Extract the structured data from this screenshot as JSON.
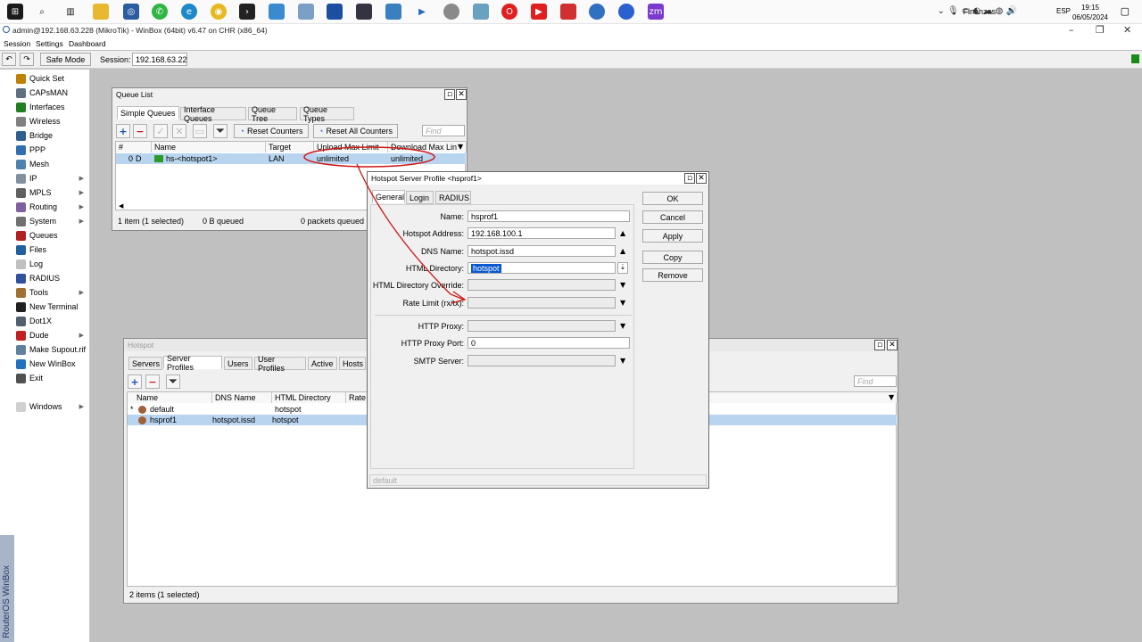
{
  "taskbar": {
    "tray_label": "Finanzas",
    "lang": "ESP",
    "time": "19:15",
    "date": "06/05/2024",
    "icons": [
      "windows-start-icon",
      "search-icon",
      "task-view-icon",
      "file-explorer-icon",
      "winbox-icon",
      "whatsapp-icon",
      "edge-icon",
      "chrome-icon",
      "terminal-icon",
      "app-icon",
      "app-icon",
      "app-icon",
      "app-icon",
      "app-icon",
      "media-player-icon",
      "app-icon",
      "app-icon",
      "opera-icon",
      "youtube-icon",
      "app-icon",
      "browser-icon",
      "zoom-icon"
    ],
    "zoom_label": "zm"
  },
  "window": {
    "title": "admin@192.168.63.228 (MikroTik) - WinBox (64bit) v6.47 on CHR (x86_64)",
    "menu": [
      "Session",
      "Settings",
      "Dashboard"
    ],
    "safe_mode": "Safe Mode",
    "session_label": "Session:",
    "session_value": "192.168.63.228"
  },
  "sidebar": {
    "items": [
      {
        "label": "Quick Set",
        "icon": "quick-set-icon",
        "color": "#c08000"
      },
      {
        "label": "CAPsMAN",
        "icon": "capsman-icon",
        "color": "#607080"
      },
      {
        "label": "Interfaces",
        "icon": "interfaces-icon",
        "color": "#208020"
      },
      {
        "label": "Wireless",
        "icon": "wireless-icon",
        "color": "#808080"
      },
      {
        "label": "Bridge",
        "icon": "bridge-icon",
        "color": "#306090"
      },
      {
        "label": "PPP",
        "icon": "ppp-icon",
        "color": "#3070b0"
      },
      {
        "label": "Mesh",
        "icon": "mesh-icon",
        "color": "#5080b0"
      },
      {
        "label": "IP",
        "icon": "ip-icon",
        "color": "#8090a0",
        "arrow": true
      },
      {
        "label": "MPLS",
        "icon": "mpls-icon",
        "color": "#606060",
        "arrow": true
      },
      {
        "label": "Routing",
        "icon": "routing-icon",
        "color": "#8060a0",
        "arrow": true
      },
      {
        "label": "System",
        "icon": "system-icon",
        "color": "#707070",
        "arrow": true
      },
      {
        "label": "Queues",
        "icon": "queues-icon",
        "color": "#b02020"
      },
      {
        "label": "Files",
        "icon": "files-icon",
        "color": "#2060a0"
      },
      {
        "label": "Log",
        "icon": "log-icon",
        "color": "#c0c0c0"
      },
      {
        "label": "RADIUS",
        "icon": "radius-icon",
        "color": "#3050a0"
      },
      {
        "label": "Tools",
        "icon": "tools-icon",
        "color": "#a07030",
        "arrow": true
      },
      {
        "label": "New Terminal",
        "icon": "terminal-icon",
        "color": "#202020"
      },
      {
        "label": "Dot1X",
        "icon": "dot1x-icon",
        "color": "#506070"
      },
      {
        "label": "Dude",
        "icon": "dude-icon",
        "color": "#c02020",
        "arrow": true
      },
      {
        "label": "Make Supout.rif",
        "icon": "supout-icon",
        "color": "#6080a0"
      },
      {
        "label": "New WinBox",
        "icon": "winbox-icon",
        "color": "#2070c0"
      },
      {
        "label": "Exit",
        "icon": "exit-icon",
        "color": "#505050"
      },
      {
        "label": "Windows",
        "icon": "windows-icon",
        "color": "#d0d0d0",
        "arrow": true
      }
    ],
    "vertical_label": "RouterOS WinBox"
  },
  "queue_list": {
    "title": "Queue List",
    "tabs": [
      "Simple Queues",
      "Interface Queues",
      "Queue Tree",
      "Queue Types"
    ],
    "reset_counters": "Reset Counters",
    "reset_all": "Reset All Counters",
    "find_placeholder": "Find",
    "columns": [
      "#",
      "Name",
      "Target",
      "Upload Max Limit",
      "Download Max Lin"
    ],
    "rows": [
      {
        "num": "0",
        "flag": "D",
        "name": "hs-<hotspot1>",
        "target": "LAN",
        "upload": "unlimited",
        "download": "unlimited"
      }
    ],
    "status": [
      "1 item (1 selected)",
      "0 B queued",
      "0 packets queued"
    ]
  },
  "hotspot": {
    "title": "Hotspot",
    "tabs": [
      "Servers",
      "Server Profiles",
      "Users",
      "User Profiles",
      "Active",
      "Hosts"
    ],
    "find_placeholder": "Find",
    "columns": [
      "Name",
      "DNS Name",
      "HTML Directory",
      "Rate L"
    ],
    "rows": [
      {
        "marker": "*",
        "name": "default",
        "dns": "",
        "dir": "hotspot"
      },
      {
        "marker": "",
        "name": "hsprof1",
        "dns": "hotspot.issd",
        "dir": "hotspot"
      }
    ],
    "status": "2 items (1 selected)"
  },
  "profile_dialog": {
    "title": "Hotspot Server Profile <hsprof1>",
    "tabs": [
      "General",
      "Login",
      "RADIUS"
    ],
    "fields": {
      "name": {
        "label": "Name:",
        "value": "hsprof1"
      },
      "address": {
        "label": "Hotspot Address:",
        "value": "192.168.100.1"
      },
      "dns": {
        "label": "DNS Name:",
        "value": "hotspot.issd"
      },
      "dir": {
        "label": "HTML Directory:",
        "value": "hotspot"
      },
      "override": {
        "label": "HTML Directory Override:",
        "value": ""
      },
      "rate": {
        "label": "Rate Limit (rx/tx):",
        "value": ""
      },
      "proxy": {
        "label": "HTTP Proxy:",
        "value": ""
      },
      "proxy_port": {
        "label": "HTTP Proxy Port:",
        "value": "0"
      },
      "smtp": {
        "label": "SMTP Server:",
        "value": ""
      }
    },
    "buttons": [
      "OK",
      "Cancel",
      "Apply",
      "Copy",
      "Remove"
    ],
    "status": "default"
  }
}
